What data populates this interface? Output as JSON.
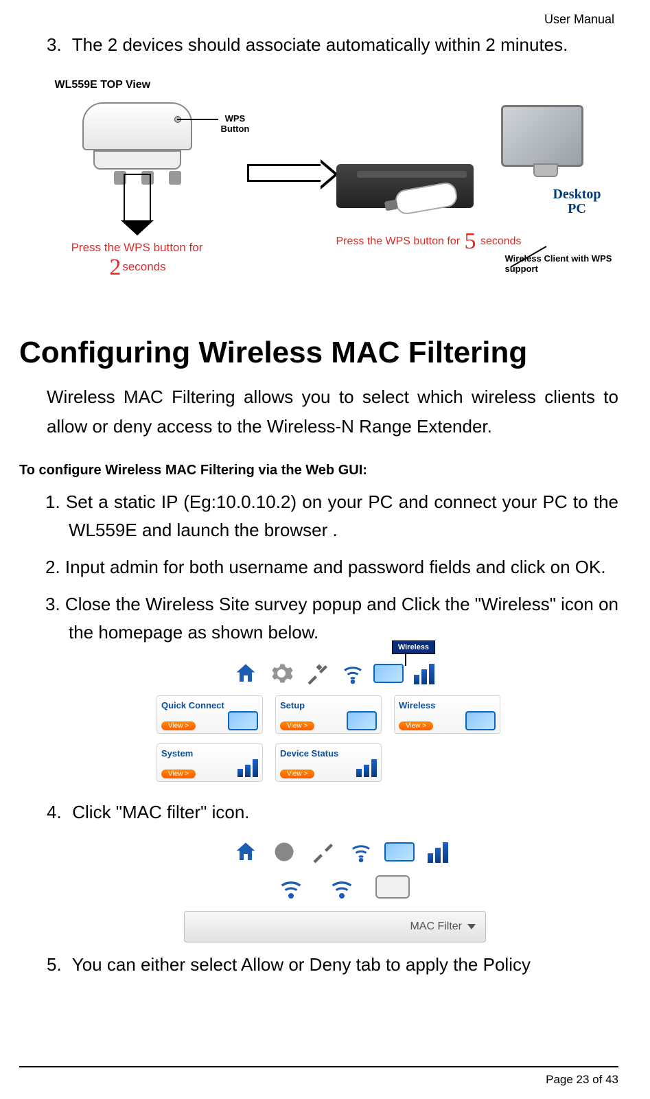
{
  "header": {
    "doc_type": "User Manual"
  },
  "top_step": {
    "num": "3.",
    "text": "The 2 devices should associate automatically within 2 minutes."
  },
  "diagram1": {
    "left_title": "WL559E TOP View",
    "wps_button_label": "WPS Button",
    "left_press_pre": "Press the WPS button for",
    "left_press_num": "2",
    "left_press_post": "seconds",
    "right_press_pre": "Press the WPS button for",
    "right_press_num": "5",
    "right_press_post": "seconds",
    "desktop_label_line1": "Desktop",
    "desktop_label_line2": "PC",
    "wireless_client_label": "Wireless Client with WPS support"
  },
  "h1": "Configuring Wireless MAC Filtering",
  "intro_para": "Wireless MAC Filtering allows you to select which wireless clients to allow or deny access to the Wireless-N Range Extender.",
  "sub_heading": "To configure Wireless MAC Filtering via the Web GUI:",
  "steps": [
    {
      "num": "1.",
      "text": "Set a static IP (Eg:10.0.10.2) on your PC and connect your PC to the WL559E and launch the browser ."
    },
    {
      "num": "2.",
      "text": "Input admin for both username and password fields and click on OK."
    },
    {
      "num": "3.",
      "text": "Close the Wireless Site survey popup and Click the \"Wireless\" icon on the homepage as shown below."
    }
  ],
  "gui1": {
    "callout": "Wireless",
    "cards": [
      {
        "name": "Quick Connect",
        "btn": "View >"
      },
      {
        "name": "Setup",
        "btn": "View >"
      },
      {
        "name": "Wireless",
        "btn": "View >"
      },
      {
        "name": "System",
        "btn": "View >"
      },
      {
        "name": "Device Status",
        "btn": "View >"
      }
    ]
  },
  "step4": {
    "num": "4.",
    "text": "Click \"MAC filter\" icon."
  },
  "gui2": {
    "dropdown_label": "MAC Filter"
  },
  "step5": {
    "num": "5.",
    "text": "You can either select Allow or Deny tab to apply the Policy"
  },
  "footer": {
    "text": "Page 23 of 43"
  }
}
